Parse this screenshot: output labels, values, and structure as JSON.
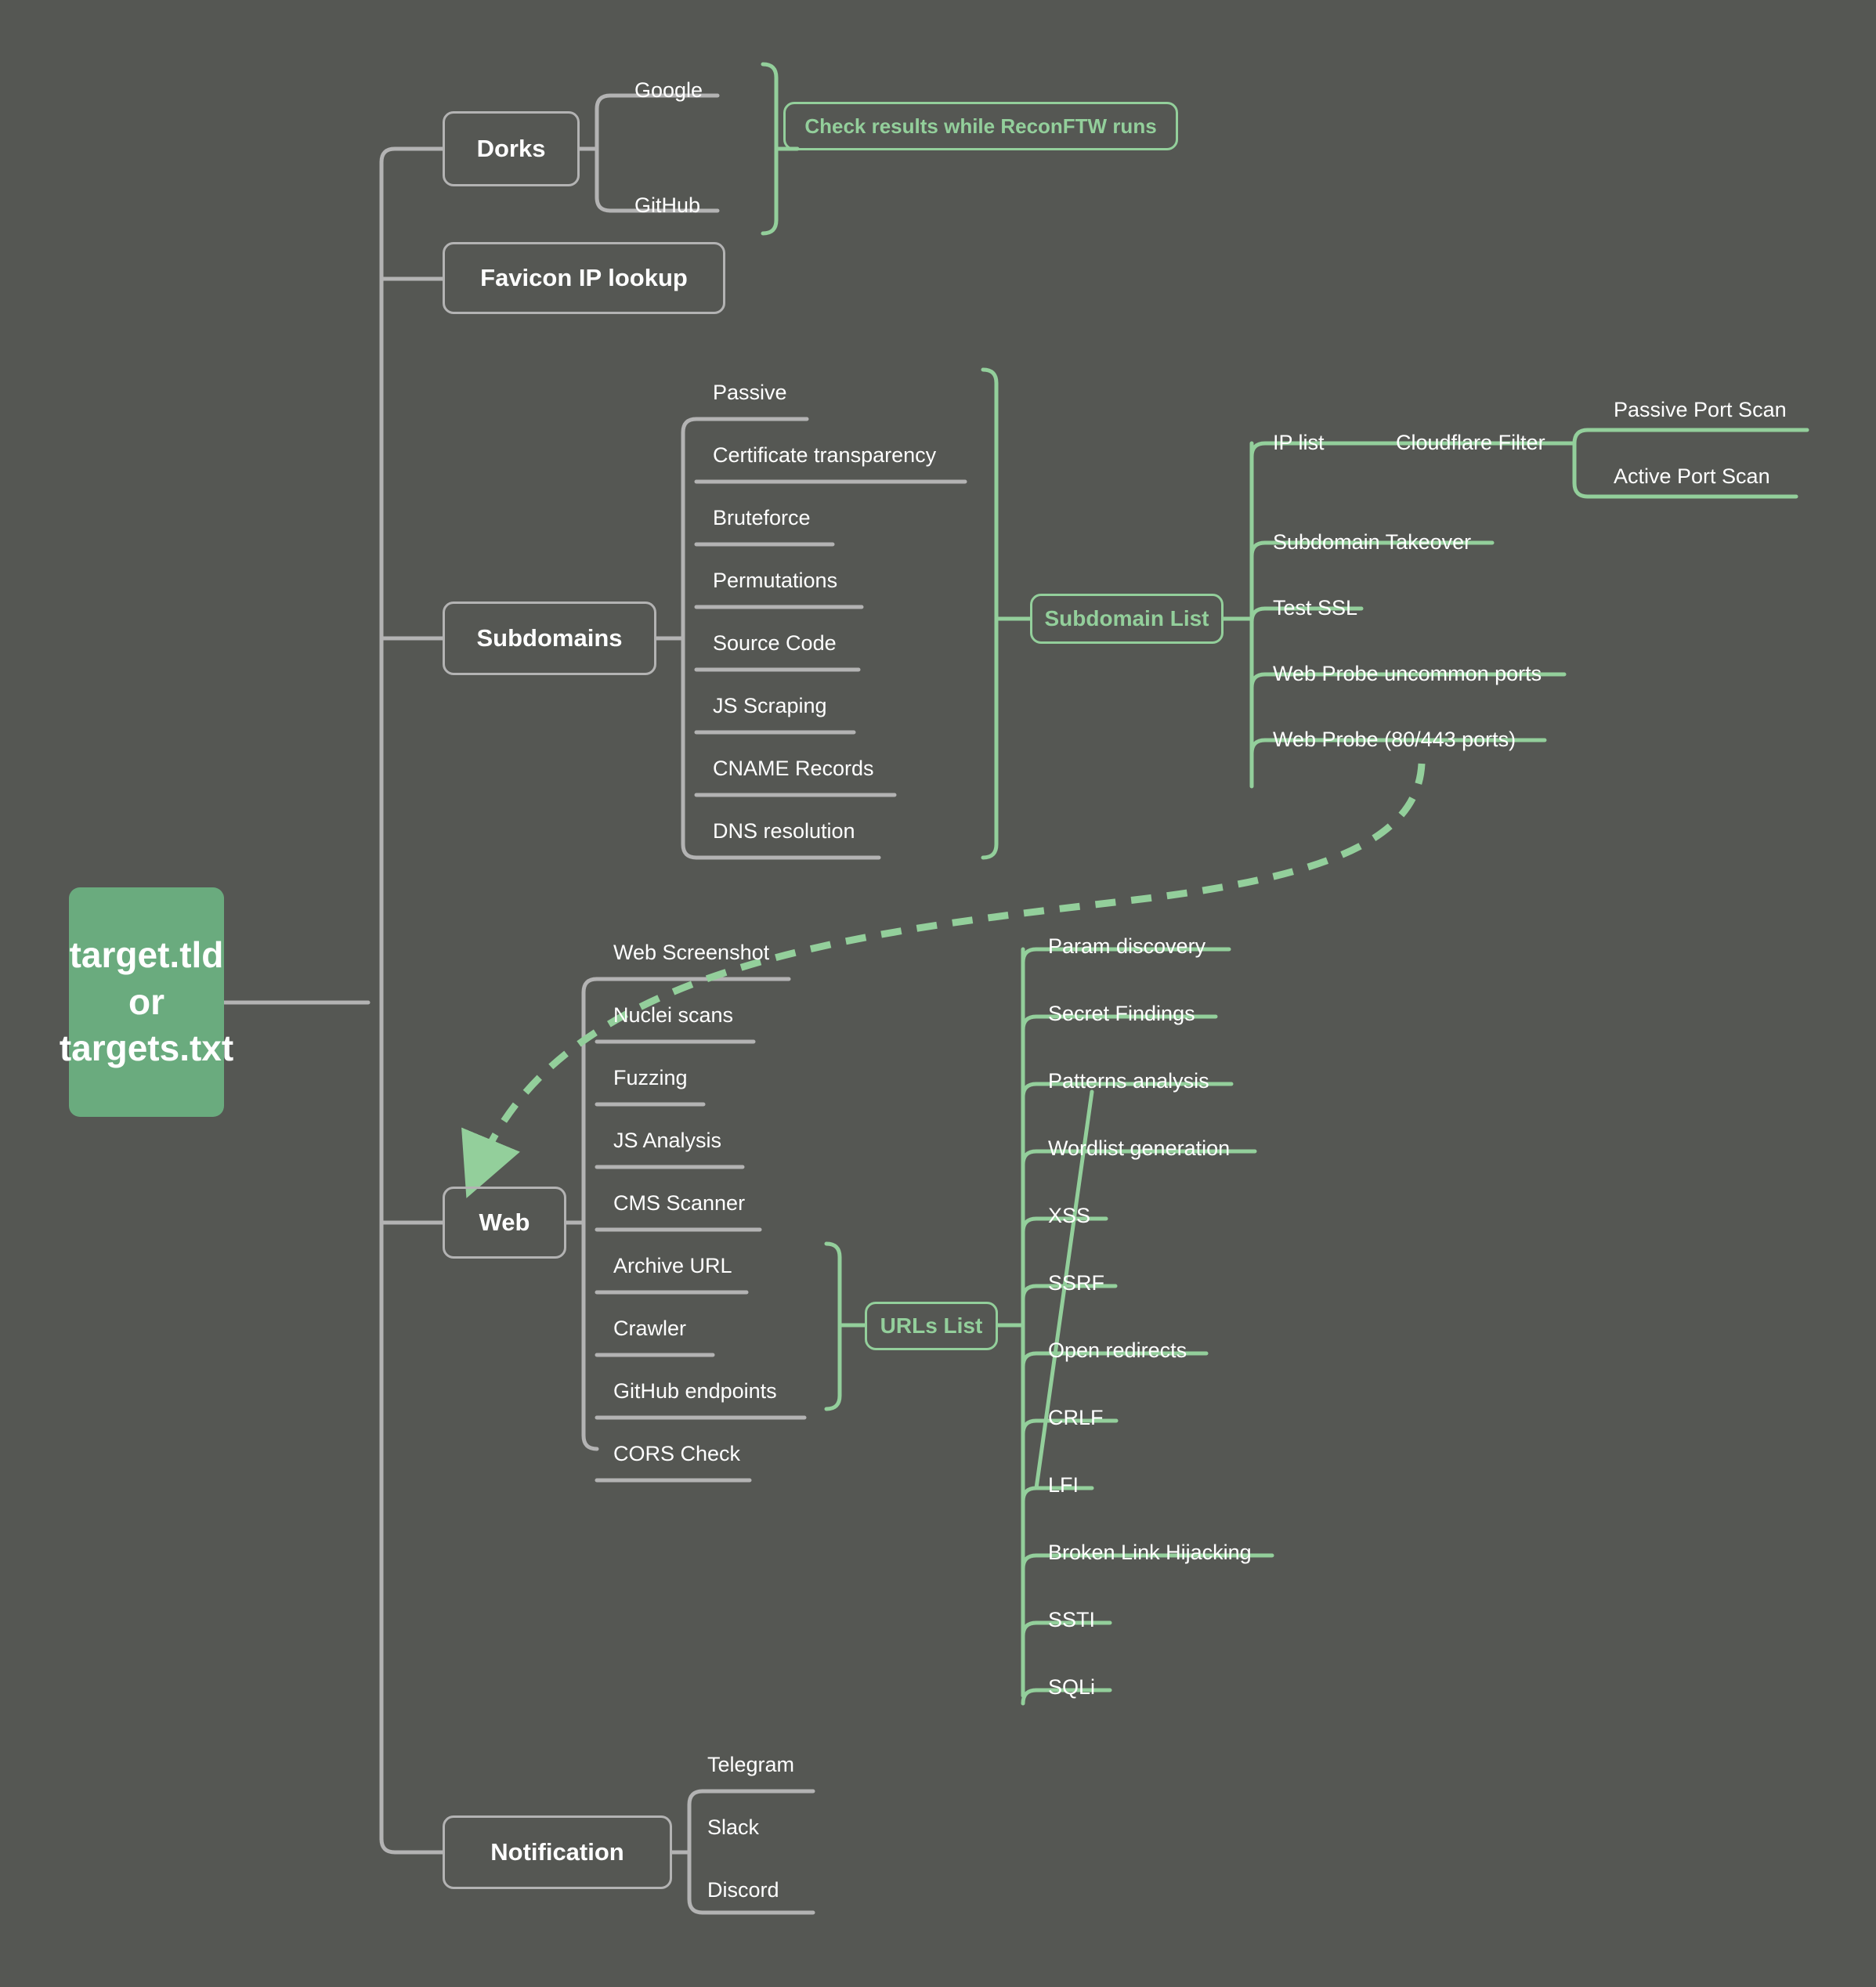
{
  "diagram": {
    "title": "ReconFTW reconnaissance workflow mindmap",
    "background_color": "#555753",
    "accent_green": "#93cf9b",
    "root_fill": "#6aab7e",
    "branch_gray": "#b3b3b3",
    "text_color": "#ffffff"
  },
  "root": {
    "line1": "target.tld",
    "line2": "or",
    "line3": "targets.txt"
  },
  "branches": {
    "dorks": {
      "label": "Dorks",
      "children": [
        "Google",
        "GitHub"
      ],
      "callout": "Check results while ReconFTW runs"
    },
    "favicon": {
      "label": "Favicon IP lookup"
    },
    "subdomains": {
      "label": "Subdomains",
      "children": [
        "Passive",
        "Certificate transparency",
        "Bruteforce",
        "Permutations",
        "Source Code",
        "JS Scraping",
        "CNAME Records",
        "DNS resolution"
      ],
      "aggregate": "Subdomain List",
      "aggregate_children": [
        "IP list",
        "Cloudflare Filter",
        "Subdomain Takeover",
        "Test SSL",
        "Web Probe uncommon ports",
        "Web Probe (80/443 ports)"
      ],
      "port_scans": [
        "Passive Port Scan",
        "Active Port Scan"
      ]
    },
    "web": {
      "label": "Web",
      "children": [
        "Web Screenshot",
        "Nuclei scans",
        "Fuzzing",
        "JS Analysis",
        "CMS Scanner",
        "Archive URL",
        "Crawler",
        "GitHub endpoints",
        "CORS Check"
      ],
      "aggregate": "URLs List",
      "aggregate_children": [
        "Param discovery",
        "Secret Findings",
        "Patterns analysis",
        "Wordlist generation",
        "XSS",
        "SSRF",
        "Open redirects",
        "CRLF",
        "LFI",
        "Broken Link Hijacking",
        "SSTI",
        "SQLi"
      ]
    },
    "notification": {
      "label": "Notification",
      "children": [
        "Telegram",
        "Slack",
        "Discord"
      ]
    }
  }
}
